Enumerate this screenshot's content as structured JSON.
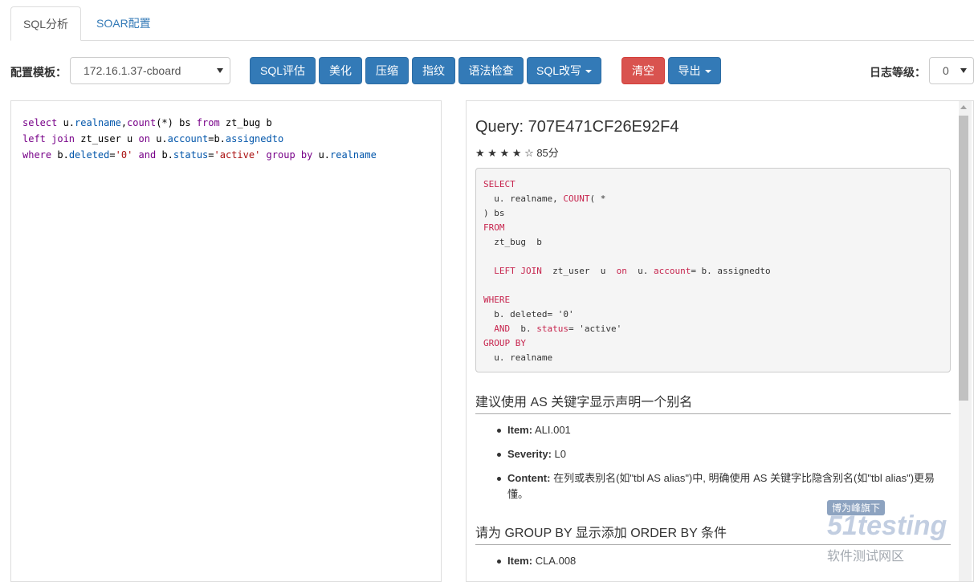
{
  "tabs": {
    "analysis": "SQL分析",
    "soar": "SOAR配置"
  },
  "toolbar": {
    "template_label": "配置模板：",
    "template_value": "172.16.1.37-cboard",
    "buttons": {
      "evaluate": "SQL评估",
      "beautify": "美化",
      "compress": "压缩",
      "fingerprint": "指纹",
      "syntax": "语法检查",
      "rewrite": "SQL改写",
      "clear": "清空",
      "export": "导出"
    },
    "log_label": "日志等级：",
    "log_value": "0"
  },
  "editor": {
    "line1": {
      "a": "select",
      "b": " u.",
      "c": "realname",
      ",": ",",
      "d": "count",
      "e": "(*) bs ",
      "f": "from",
      "g": " zt_bug b"
    },
    "line2": {
      "a": "left join",
      "b": " zt_user u ",
      "c": "on",
      "d": " u.",
      "e": "account",
      "f": "=b.",
      "g": "assignedto"
    },
    "line3": {
      "a": "where",
      "b": " b.",
      "c": "deleted",
      "d": "=",
      "e": "'0'",
      "f": " ",
      "g": "and",
      "h": " b.",
      "i": "status",
      "j": "=",
      "k": "'active'",
      "l": " ",
      "m": "group by",
      "n": " u.",
      "o": "realname"
    }
  },
  "result": {
    "title": "Query: 707E471CF26E92F4",
    "rating": "★ ★ ★ ★ ☆ 85分",
    "formatted": {
      "l1": "SELECT",
      "l2a": "  u. realname, ",
      "l2b": "COUNT",
      "l2c": "( *",
      "l3": ") bs",
      "l4": "FROM",
      "l5": "  zt_bug  b",
      "l7a": "  ",
      "l7b": "LEFT JOIN",
      "l7c": "  zt_user  u  ",
      "l7d": "on",
      "l7e": "  u. ",
      "l7f": "account",
      "l7g": "= b. assignedto",
      "l9": "WHERE",
      "l10": "  b. deleted= '0'",
      "l11a": "  ",
      "l11b": "AND",
      "l11c": "  b. ",
      "l11d": "status",
      "l11e": "= 'active'",
      "l12": "GROUP BY",
      "l13": "  u. realname"
    },
    "sections": [
      {
        "heading": "建议使用 AS 关键字显示声明一个别名",
        "item_label": "Item:",
        "item": "ALI.001",
        "severity_label": "Severity:",
        "severity": "L0",
        "content_label": "Content:",
        "content": "在列或表别名(如\"tbl AS alias\")中, 明确使用 AS 关键字比隐含别名(如\"tbl alias\")更易懂。"
      },
      {
        "heading": "请为 GROUP BY 显示添加 ORDER BY 条件",
        "item_label": "Item:",
        "item": "CLA.008"
      }
    ]
  },
  "watermark": {
    "badge": "博为峰旗下",
    "logo": "51testing",
    "text": "软件测试网区"
  }
}
